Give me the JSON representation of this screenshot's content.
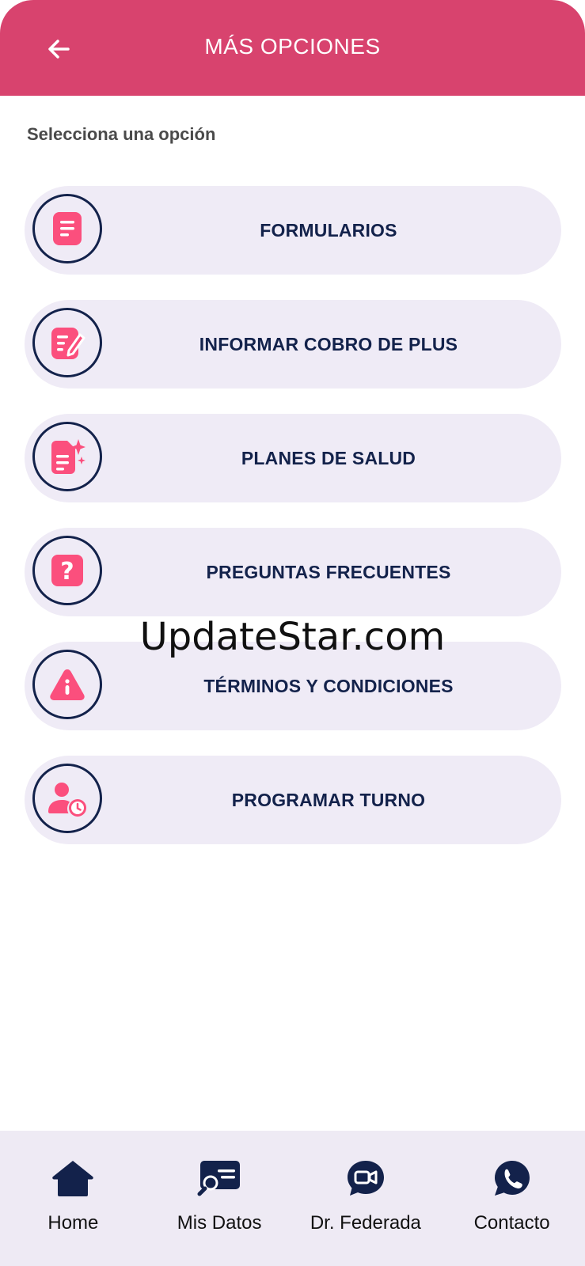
{
  "header": {
    "title": "MÁS OPCIONES",
    "back_icon": "arrow-left-icon",
    "background": "#d8436e"
  },
  "subtitle": "Selecciona una opción",
  "menu": [
    {
      "label": "FORMULARIOS",
      "icon": "document-icon"
    },
    {
      "label": "INFORMAR COBRO DE PLUS",
      "icon": "edit-document-icon"
    },
    {
      "label": "PLANES DE SALUD",
      "icon": "document-sparkle-icon"
    },
    {
      "label": "PREGUNTAS FRECUENTES",
      "icon": "question-icon"
    },
    {
      "label": "TÉRMINOS Y CONDICIONES",
      "icon": "warning-icon"
    },
    {
      "label": "PROGRAMAR TURNO",
      "icon": "user-clock-icon"
    }
  ],
  "watermark": "UpdateStar.com",
  "bottom_nav": [
    {
      "label": "Home",
      "icon": "home-icon"
    },
    {
      "label": "Mis Datos",
      "icon": "id-card-search-icon"
    },
    {
      "label": "Dr. Federada",
      "icon": "video-chat-icon"
    },
    {
      "label": "Contacto",
      "icon": "whatsapp-icon"
    }
  ],
  "colors": {
    "accent": "#d8436e",
    "icon_pink": "#fb4f7d",
    "navy": "#13224b",
    "item_bg": "#efebf6"
  }
}
